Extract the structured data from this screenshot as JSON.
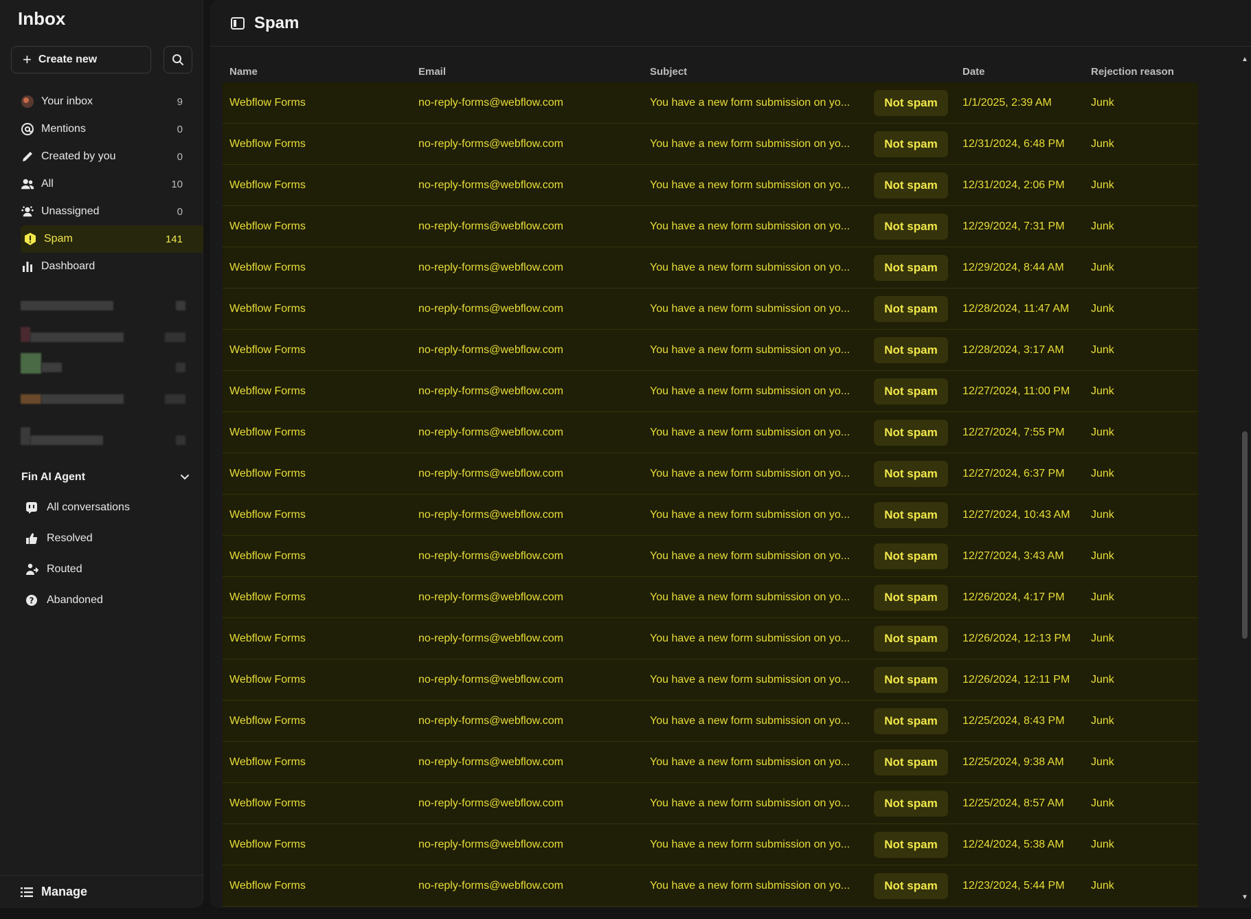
{
  "sidebar": {
    "title": "Inbox",
    "create_label": "Create new",
    "nav": [
      {
        "label": "Your inbox",
        "count": "9"
      },
      {
        "label": "Mentions",
        "count": "0"
      },
      {
        "label": "Created by you",
        "count": "0"
      },
      {
        "label": "All",
        "count": "10"
      },
      {
        "label": "Unassigned",
        "count": "0"
      },
      {
        "label": "Spam",
        "count": "141"
      },
      {
        "label": "Dashboard",
        "count": ""
      }
    ],
    "fin_section": {
      "title": "Fin AI Agent",
      "items": [
        {
          "label": "All conversations"
        },
        {
          "label": "Resolved"
        },
        {
          "label": "Routed"
        },
        {
          "label": "Abandoned"
        }
      ]
    },
    "manage_label": "Manage"
  },
  "main": {
    "title": "Spam",
    "columns": {
      "name": "Name",
      "email": "Email",
      "subject": "Subject",
      "date": "Date",
      "reason": "Rejection reason"
    },
    "not_spam_label": "Not spam",
    "rows": [
      {
        "name": "Webflow Forms",
        "email": "no-reply-forms@webflow.com",
        "subject": "You have a new form submission on yo...",
        "date": "1/1/2025, 2:39 AM",
        "reason": "Junk"
      },
      {
        "name": "Webflow Forms",
        "email": "no-reply-forms@webflow.com",
        "subject": "You have a new form submission on yo...",
        "date": "12/31/2024, 6:48 PM",
        "reason": "Junk"
      },
      {
        "name": "Webflow Forms",
        "email": "no-reply-forms@webflow.com",
        "subject": "You have a new form submission on yo...",
        "date": "12/31/2024, 2:06 PM",
        "reason": "Junk"
      },
      {
        "name": "Webflow Forms",
        "email": "no-reply-forms@webflow.com",
        "subject": "You have a new form submission on yo...",
        "date": "12/29/2024, 7:31 PM",
        "reason": "Junk"
      },
      {
        "name": "Webflow Forms",
        "email": "no-reply-forms@webflow.com",
        "subject": "You have a new form submission on yo...",
        "date": "12/29/2024, 8:44 AM",
        "reason": "Junk"
      },
      {
        "name": "Webflow Forms",
        "email": "no-reply-forms@webflow.com",
        "subject": "You have a new form submission on yo...",
        "date": "12/28/2024, 11:47 AM",
        "reason": "Junk"
      },
      {
        "name": "Webflow Forms",
        "email": "no-reply-forms@webflow.com",
        "subject": "You have a new form submission on yo...",
        "date": "12/28/2024, 3:17 AM",
        "reason": "Junk"
      },
      {
        "name": "Webflow Forms",
        "email": "no-reply-forms@webflow.com",
        "subject": "You have a new form submission on yo...",
        "date": "12/27/2024, 11:00 PM",
        "reason": "Junk"
      },
      {
        "name": "Webflow Forms",
        "email": "no-reply-forms@webflow.com",
        "subject": "You have a new form submission on yo...",
        "date": "12/27/2024, 7:55 PM",
        "reason": "Junk"
      },
      {
        "name": "Webflow Forms",
        "email": "no-reply-forms@webflow.com",
        "subject": "You have a new form submission on yo...",
        "date": "12/27/2024, 6:37 PM",
        "reason": "Junk"
      },
      {
        "name": "Webflow Forms",
        "email": "no-reply-forms@webflow.com",
        "subject": "You have a new form submission on yo...",
        "date": "12/27/2024, 10:43 AM",
        "reason": "Junk"
      },
      {
        "name": "Webflow Forms",
        "email": "no-reply-forms@webflow.com",
        "subject": "You have a new form submission on yo...",
        "date": "12/27/2024, 3:43 AM",
        "reason": "Junk"
      },
      {
        "name": "Webflow Forms",
        "email": "no-reply-forms@webflow.com",
        "subject": "You have a new form submission on yo...",
        "date": "12/26/2024, 4:17 PM",
        "reason": "Junk"
      },
      {
        "name": "Webflow Forms",
        "email": "no-reply-forms@webflow.com",
        "subject": "You have a new form submission on yo...",
        "date": "12/26/2024, 12:13 PM",
        "reason": "Junk"
      },
      {
        "name": "Webflow Forms",
        "email": "no-reply-forms@webflow.com",
        "subject": "You have a new form submission on yo...",
        "date": "12/26/2024, 12:11 PM",
        "reason": "Junk"
      },
      {
        "name": "Webflow Forms",
        "email": "no-reply-forms@webflow.com",
        "subject": "You have a new form submission on yo...",
        "date": "12/25/2024, 8:43 PM",
        "reason": "Junk"
      },
      {
        "name": "Webflow Forms",
        "email": "no-reply-forms@webflow.com",
        "subject": "You have a new form submission on yo...",
        "date": "12/25/2024, 9:38 AM",
        "reason": "Junk"
      },
      {
        "name": "Webflow Forms",
        "email": "no-reply-forms@webflow.com",
        "subject": "You have a new form submission on yo...",
        "date": "12/25/2024, 8:57 AM",
        "reason": "Junk"
      },
      {
        "name": "Webflow Forms",
        "email": "no-reply-forms@webflow.com",
        "subject": "You have a new form submission on yo...",
        "date": "12/24/2024, 5:38 AM",
        "reason": "Junk"
      },
      {
        "name": "Webflow Forms",
        "email": "no-reply-forms@webflow.com",
        "subject": "You have a new form submission on yo...",
        "date": "12/23/2024, 5:44 PM",
        "reason": "Junk"
      }
    ]
  },
  "colors": {
    "accent": "#f2e84b",
    "row_bg": "#1f1e06",
    "button_bg": "#34330b",
    "sidebar_bg": "#1c1c1c"
  },
  "icons": [
    "plus-icon",
    "search-icon",
    "avatar-icon",
    "at-icon",
    "pencil-icon",
    "people-icon",
    "unassigned-icon",
    "spam-icon",
    "bar-chart-icon",
    "chevron-down-icon",
    "conversations-icon",
    "thumbs-up-icon",
    "route-icon",
    "question-icon",
    "list-icon",
    "sidebar-toggle-icon"
  ]
}
